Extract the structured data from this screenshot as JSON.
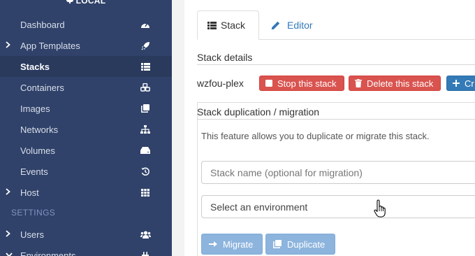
{
  "sidebar": {
    "environment": "LOCAL",
    "items": [
      {
        "label": "Dashboard",
        "icon": "tachometer-icon"
      },
      {
        "label": "App Templates",
        "icon": "rocket-icon"
      },
      {
        "label": "Stacks",
        "icon": "th-list-icon"
      },
      {
        "label": "Containers",
        "icon": "cubes-icon"
      },
      {
        "label": "Images",
        "icon": "clone-icon"
      },
      {
        "label": "Networks",
        "icon": "sitemap-icon"
      },
      {
        "label": "Volumes",
        "icon": "hdd-icon"
      },
      {
        "label": "Events",
        "icon": "history-icon"
      },
      {
        "label": "Host",
        "icon": "th-icon"
      }
    ],
    "settings_header": "SETTINGS",
    "settings_items": [
      {
        "label": "Users",
        "icon": "users-icon"
      },
      {
        "label": "Environments",
        "icon": "plug-icon"
      }
    ]
  },
  "tabs": [
    {
      "label": "Stack",
      "icon": "th-list-icon"
    },
    {
      "label": "Editor",
      "icon": "pencil-icon"
    }
  ],
  "stack_details": {
    "title": "Stack details",
    "stack_name": "wzfou-plex",
    "stop_label": "Stop this stack",
    "delete_label": "Delete this stack",
    "create_label": "Cr"
  },
  "migration": {
    "title": "Stack duplication / migration",
    "description": "This feature allows you to duplicate or migrate this stack.",
    "name_placeholder": "Stack name (optional for migration)",
    "environment_select": "Select an environment",
    "migrate_label": "Migrate",
    "duplicate_label": "Duplicate"
  },
  "colors": {
    "sidebar_bg": "#30426a",
    "danger": "#d9534f",
    "primary": "#337ab7",
    "primary_disabled": "#8cb4dd"
  }
}
